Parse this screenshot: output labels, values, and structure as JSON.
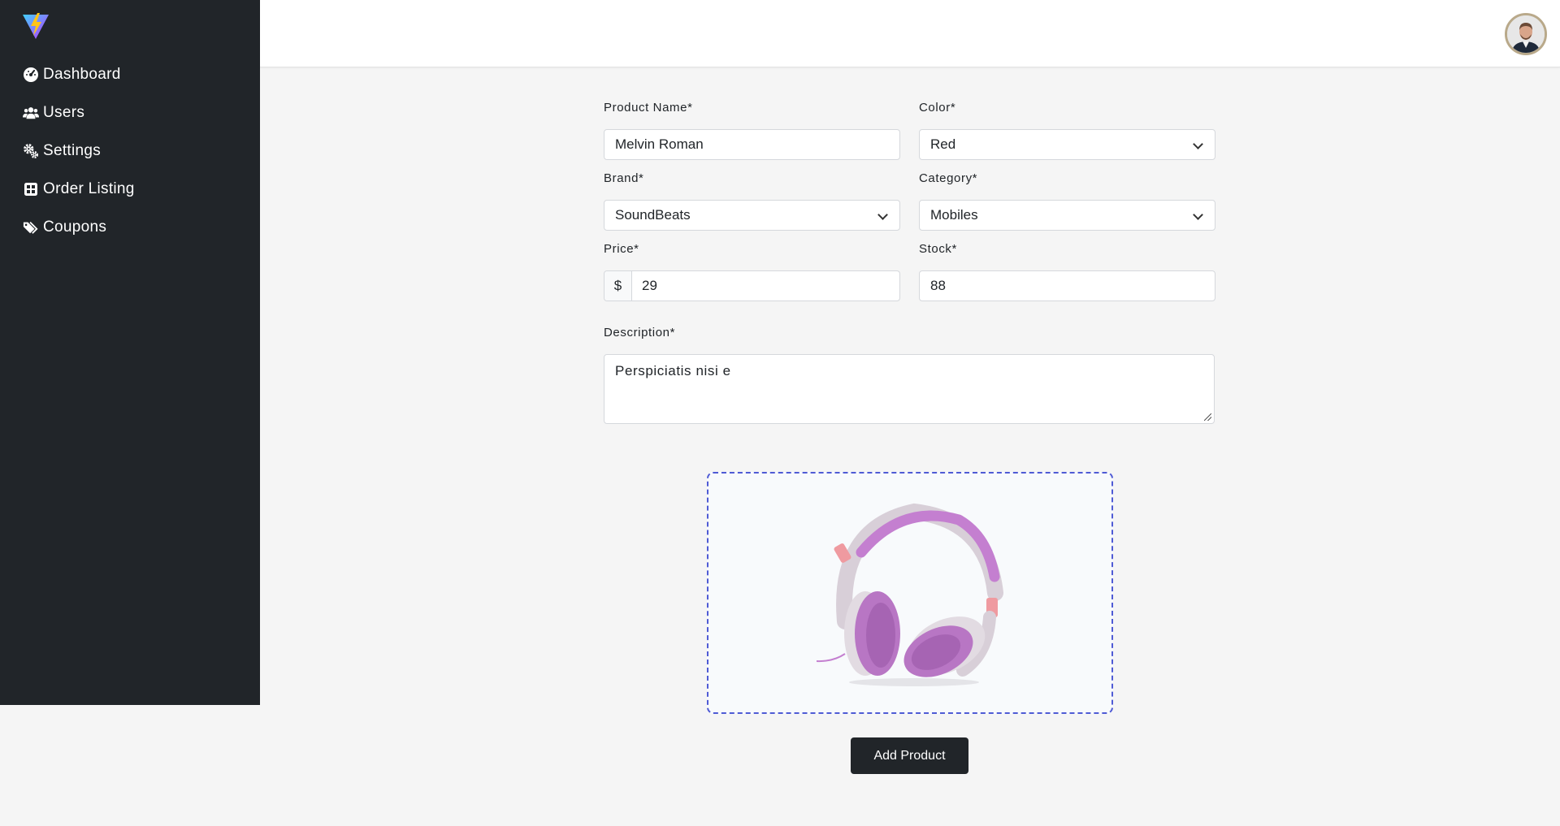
{
  "sidebar": {
    "items": [
      {
        "label": "Dashboard",
        "icon": "dashboard-icon"
      },
      {
        "label": "Users",
        "icon": "users-icon"
      },
      {
        "label": "Settings",
        "icon": "gears-icon"
      },
      {
        "label": "Order Listing",
        "icon": "grid-icon"
      },
      {
        "label": "Coupons",
        "icon": "tags-icon"
      }
    ]
  },
  "form": {
    "product_name": {
      "label": "Product Name*",
      "value": "Melvin Roman"
    },
    "color": {
      "label": "Color*",
      "value": "Red"
    },
    "brand": {
      "label": "Brand*",
      "value": "SoundBeats"
    },
    "category": {
      "label": "Category*",
      "value": "Mobiles"
    },
    "price": {
      "label": "Price*",
      "currency": "$",
      "value": "29"
    },
    "stock": {
      "label": "Stock*",
      "value": "88"
    },
    "description": {
      "label": "Description*",
      "value": "Perspiciatis nisi e"
    }
  },
  "upload": {
    "image": "headphones-product-image"
  },
  "actions": {
    "add_label": "Add Product"
  },
  "colors": {
    "sidebar_bg": "#212529",
    "dropzone_border": "#4f5bd5",
    "button_bg": "#212529"
  }
}
